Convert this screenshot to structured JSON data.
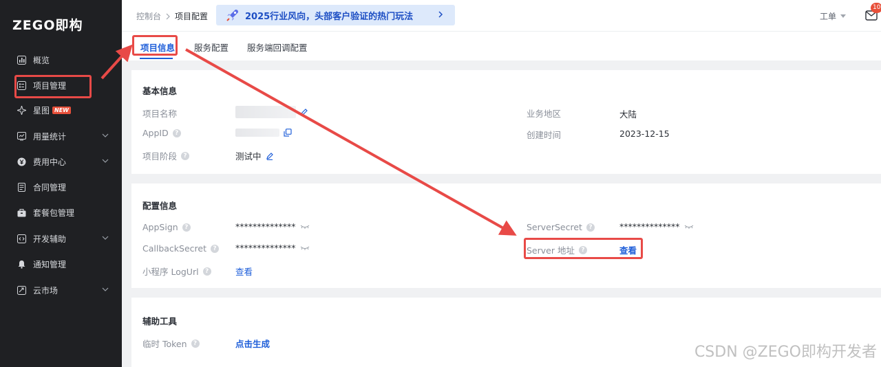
{
  "logo": {
    "text": "ZEGO即构"
  },
  "sidebar": {
    "items": [
      {
        "label": "概览",
        "icon": "chart-icon",
        "expandable": false
      },
      {
        "label": "项目管理",
        "icon": "list-icon",
        "expandable": false
      },
      {
        "label": "星图",
        "icon": "star-icon",
        "expandable": false,
        "badge": "NEW"
      },
      {
        "label": "用量统计",
        "icon": "usage-icon",
        "expandable": true
      },
      {
        "label": "费用中心",
        "icon": "yen-icon",
        "expandable": true
      },
      {
        "label": "合同管理",
        "icon": "contract-icon",
        "expandable": false
      },
      {
        "label": "套餐包管理",
        "icon": "package-icon",
        "expandable": false
      },
      {
        "label": "开发辅助",
        "icon": "code-icon",
        "expandable": true
      },
      {
        "label": "通知管理",
        "icon": "bell-icon",
        "expandable": false
      },
      {
        "label": "云市场",
        "icon": "market-icon",
        "expandable": true
      }
    ]
  },
  "header": {
    "breadcrumb": [
      "控制台",
      "项目配置"
    ],
    "banner": "2025行业风向，头部客户验证的热门玩法",
    "ticket": "工单",
    "mail_count": "10"
  },
  "tabs": [
    "项目信息",
    "服务配置",
    "服务端回调配置"
  ],
  "basic": {
    "title": "基本信息",
    "project_name_label": "项目名称",
    "appid_label": "AppID",
    "stage_label": "项目阶段",
    "stage_value": "测试中",
    "region_label": "业务地区",
    "region_value": "大陆",
    "created_label": "创建时间",
    "created_value": "2023-12-15"
  },
  "config": {
    "title": "配置信息",
    "appsign_label": "AppSign",
    "appsign_value": "**************",
    "callback_label": "CallbackSecret",
    "callback_value": "**************",
    "logurl_label": "小程序 LogUrl",
    "logurl_value": "查看",
    "serversecret_label": "ServerSecret",
    "serversecret_value": "**************",
    "server_label": "Server 地址",
    "server_value": "查看"
  },
  "tools": {
    "title": "辅助工具",
    "token_label": "临时 Token",
    "token_value": "点击生成"
  },
  "watermark": "CSDN @ZEGO即构开发者",
  "colors": {
    "accent": "#1e5ed9",
    "highlight": "#e84a47",
    "sidebar": "#1f2023"
  }
}
